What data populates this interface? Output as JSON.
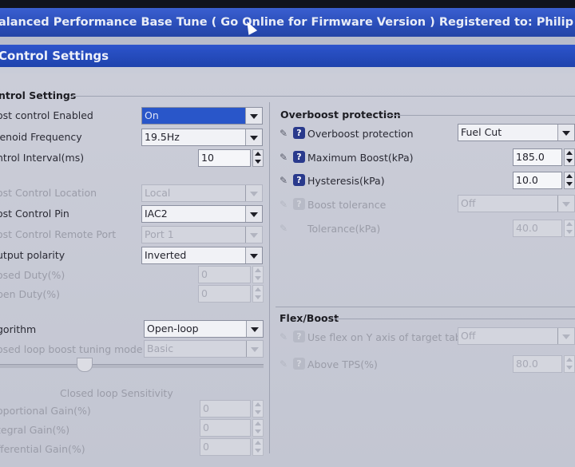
{
  "title": "alanced Performance Base Tune ( Go Online for Firmware Version ) Registered to: Philip Fortune",
  "section_header": "Control Settings",
  "left_group": {
    "title": "ntrol Settings",
    "rows": [
      {
        "label": "ost control Enabled",
        "type": "combo",
        "value": "On",
        "selected": true,
        "enabled": true
      },
      {
        "label": "lenoid Frequency",
        "type": "combo",
        "value": "19.5Hz",
        "enabled": true
      },
      {
        "label": "ntrol Interval(ms)",
        "type": "spin",
        "value": "10",
        "enabled": true
      },
      {
        "label": "ost Control Location",
        "type": "combo",
        "value": "Local",
        "enabled": false
      },
      {
        "label": "ost Control Pin",
        "type": "combo",
        "value": "IAC2",
        "enabled": true
      },
      {
        "label": "ost Control Remote Port",
        "type": "combo",
        "value": "Port 1",
        "enabled": false
      },
      {
        "label": "utput polarity",
        "type": "combo",
        "value": "Inverted",
        "enabled": true
      },
      {
        "label": "osed Duty(%)",
        "type": "spin",
        "value": "0",
        "enabled": false
      },
      {
        "label": "pen Duty(%)",
        "type": "spin",
        "value": "0",
        "enabled": false
      },
      {
        "label": "gorithm",
        "type": "combo",
        "value": "Open-loop",
        "enabled": true
      },
      {
        "label": "osed loop boost tuning mode",
        "type": "combo",
        "value": "Basic",
        "enabled": false
      }
    ],
    "sensitivity_label": "Closed loop Sensitivity",
    "gains": [
      {
        "label": "oportional Gain(%)",
        "value": "0"
      },
      {
        "label": "tegral Gain(%)",
        "value": "0"
      },
      {
        "label": "fferential Gain(%)",
        "value": "0"
      }
    ]
  },
  "overboost": {
    "title": "Overboost protection",
    "rows": [
      {
        "label": "Overboost protection",
        "type": "combo",
        "value": "Fuel Cut",
        "enabled": true
      },
      {
        "label": "Maximum Boost(kPa)",
        "type": "spin",
        "value": "185.0",
        "enabled": true
      },
      {
        "label": "Hysteresis(kPa)",
        "type": "spin",
        "value": "10.0",
        "enabled": true
      },
      {
        "label": "Boost tolerance",
        "type": "combo",
        "value": "Off",
        "enabled": false
      },
      {
        "label": "Tolerance(kPa)",
        "type": "spin",
        "value": "40.0",
        "enabled": false
      }
    ]
  },
  "flexboost": {
    "title": "Flex/Boost",
    "rows": [
      {
        "label": "Use flex on Y axis of target table",
        "type": "combo",
        "value": "Off",
        "enabled": false
      },
      {
        "label": "Above TPS(%)",
        "type": "spin",
        "value": "80.0",
        "enabled": false
      }
    ]
  },
  "icons": {
    "help": "?",
    "edit": "✎"
  },
  "colors": {
    "titlebar": "#2a4db8",
    "section": "#1f43ad",
    "selected": "#2956c9",
    "panel": "#c9ccd8"
  }
}
